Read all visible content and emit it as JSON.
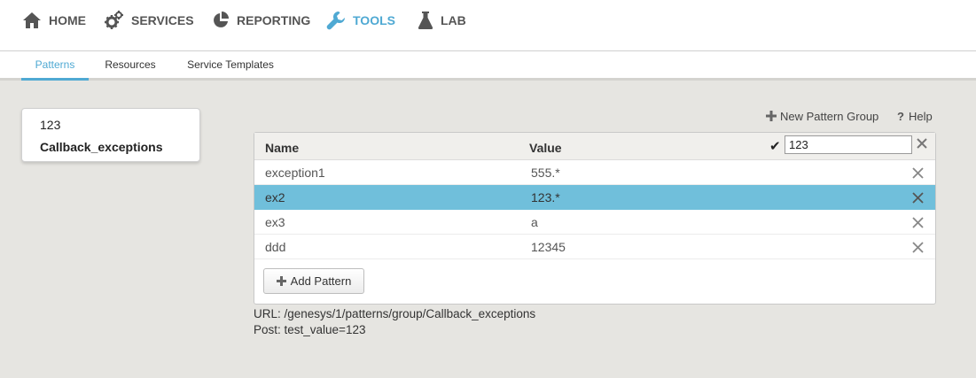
{
  "nav": {
    "items": [
      {
        "label": "HOME",
        "icon": "home-icon"
      },
      {
        "label": "SERVICES",
        "icon": "gears-icon"
      },
      {
        "label": "REPORTING",
        "icon": "pie-chart-icon"
      },
      {
        "label": "TOOLS",
        "icon": "wrench-icon",
        "active": true
      },
      {
        "label": "LAB",
        "icon": "flask-icon"
      }
    ]
  },
  "subtabs": [
    {
      "label": "Patterns",
      "active": true
    },
    {
      "label": "Resources"
    },
    {
      "label": "Service Templates"
    }
  ],
  "groups": [
    {
      "label": "123"
    },
    {
      "label": "Callback_exceptions",
      "selected": true
    }
  ],
  "actions": {
    "new_group_label": "New Pattern Group",
    "help_label": "Help"
  },
  "table": {
    "columns": [
      "Name",
      "Value"
    ],
    "filter_value": "123",
    "rows": [
      {
        "name": "exception1",
        "value": "555.*"
      },
      {
        "name": "ex2",
        "value": "123.*",
        "selected": true
      },
      {
        "name": "ex3",
        "value": "a"
      },
      {
        "name": "ddd",
        "value": "12345"
      }
    ],
    "add_label": "Add Pattern"
  },
  "info": {
    "url": "URL: /genesys/1/patterns/group/Callback_exceptions",
    "post": "Post: test_value=123"
  },
  "colors": {
    "accent": "#4fa9d3",
    "selected_row": "#70bfdb",
    "background": "#e6e5e1"
  }
}
